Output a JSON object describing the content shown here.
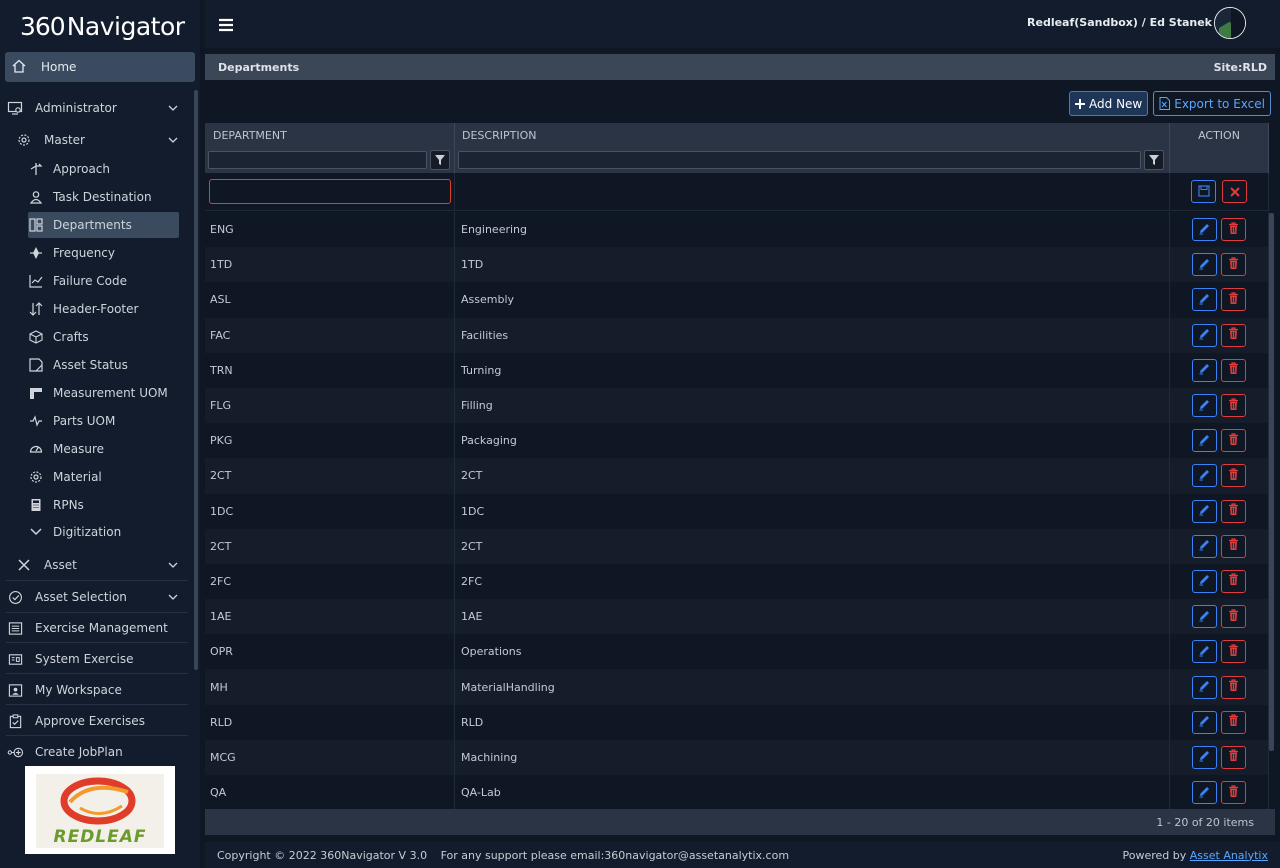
{
  "app": {
    "logo_prefix": "360",
    "logo_name": "Navigator",
    "user_label": "Redleaf(Sandbox) / Ed Stanek"
  },
  "sidebar": {
    "home": "Home",
    "administrator": "Administrator",
    "master": "Master",
    "sub_items": [
      {
        "label": "Approach",
        "icon": "approach-icon"
      },
      {
        "label": "Task Destination",
        "icon": "person-icon"
      },
      {
        "label": "Departments",
        "icon": "dashboard-icon"
      },
      {
        "label": "Frequency",
        "icon": "frequency-icon"
      },
      {
        "label": "Failure Code",
        "icon": "chart-icon"
      },
      {
        "label": "Header-Footer",
        "icon": "sort-icon"
      },
      {
        "label": "Crafts",
        "icon": "cube-icon"
      },
      {
        "label": "Asset Status",
        "icon": "tag-icon"
      },
      {
        "label": "Measurement UOM",
        "icon": "ruler-icon"
      },
      {
        "label": "Parts UOM",
        "icon": "pulse-icon"
      },
      {
        "label": "Measure",
        "icon": "gauge-icon"
      },
      {
        "label": "Material",
        "icon": "gear-icon"
      },
      {
        "label": "RPNs",
        "icon": "calculator-icon"
      },
      {
        "label": "Digitization",
        "icon": "chevron-down-icon"
      }
    ],
    "asset": "Asset",
    "asset_selection": "Asset Selection",
    "exercise_management": "Exercise Management",
    "system_exercise": "System Exercise",
    "my_workspace": "My Workspace",
    "approve_exercises": "Approve Exercises",
    "create_jobplan": "Create JobPlan",
    "client_logo_text": "REDLEAF"
  },
  "breadcrumb": {
    "title": "Departments",
    "site": "Site:RLD"
  },
  "toolbar": {
    "add_new": "Add New",
    "export": "Export to Excel"
  },
  "grid": {
    "columns": [
      "DEPARTMENT",
      "DESCRIPTION",
      "ACTION"
    ],
    "rows": [
      [
        "ENG",
        "Engineering"
      ],
      [
        "1TD",
        "1TD"
      ],
      [
        "ASL",
        "Assembly"
      ],
      [
        "FAC",
        "Facilities"
      ],
      [
        "TRN",
        "Turning"
      ],
      [
        "FLG",
        "Filling"
      ],
      [
        "PKG",
        "Packaging"
      ],
      [
        "2CT",
        "2CT"
      ],
      [
        "1DC",
        "1DC"
      ],
      [
        "2CT",
        "2CT"
      ],
      [
        "2FC",
        "2FC"
      ],
      [
        "1AE",
        "1AE"
      ],
      [
        "OPR",
        "Operations"
      ],
      [
        "MH",
        "MaterialHandling"
      ],
      [
        "RLD",
        "RLD"
      ],
      [
        "MCG",
        "Machining"
      ],
      [
        "QA",
        "QA-Lab"
      ]
    ],
    "pager": "1 - 20 of 20 items"
  },
  "footer": {
    "copyright": "Copyright © 2022 360Navigator V 3.0",
    "support": "For any support please email:360navigator@assetanalytix.com",
    "powered_by": "Powered by",
    "powered_link": "Asset Analytix"
  },
  "colors": {
    "background": "#0f1624",
    "sidebar": "#131c2c",
    "active": "#3a4a5f",
    "edit_blue": "#3b82f6",
    "delete_red": "#e23b3b"
  }
}
